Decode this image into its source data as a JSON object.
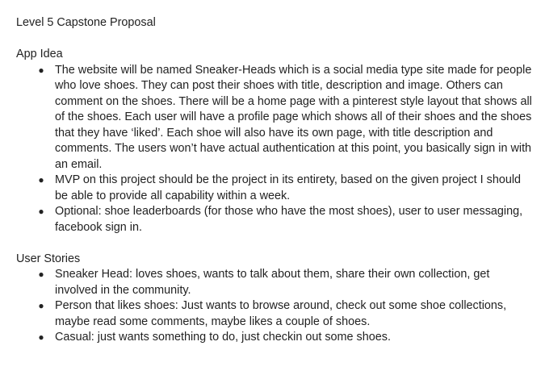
{
  "document": {
    "title": "Level 5 Capstone Proposal",
    "sections": [
      {
        "heading": "App Idea",
        "items": [
          "The website will be named Sneaker-Heads which is a social media type site made for people who love shoes. They can post their shoes with title, description and image. Others can comment on the shoes. There will be a home page with a pinterest style layout that shows all of the shoes. Each user will have a profile page which shows all of their shoes and the shoes that they have ‘liked’. Each shoe will also have its own page, with title description and comments. The users won’t have actual authentication at this point, you basically sign in with an email.",
          "MVP on this project should be the project in its entirety, based on the given project I should be able to provide all capability within a week.",
          "Optional: shoe leaderboards (for those who have the most shoes), user to user messaging, facebook sign in."
        ]
      },
      {
        "heading": "User Stories",
        "items": [
          "Sneaker Head: loves shoes, wants to talk about them, share their own collection, get involved in the community.",
          "Person that likes shoes: Just wants to browse around, check out some shoe collections, maybe read some comments, maybe likes a couple of shoes.",
          "Casual: just wants something to do, just checkin out some shoes."
        ]
      }
    ],
    "bullet_glyph": "●"
  }
}
